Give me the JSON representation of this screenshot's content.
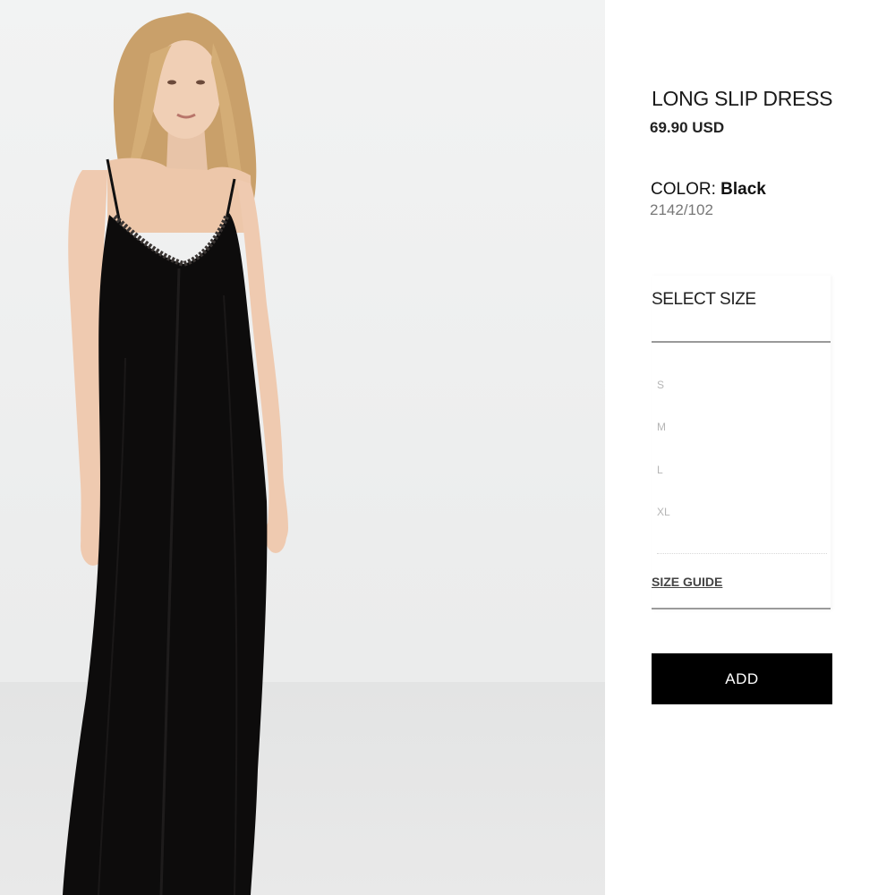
{
  "product": {
    "title": "LONG SLIP DRESS",
    "price": "69.90 USD",
    "color_label": "COLOR:",
    "color_value": "Black",
    "reference": "2142/102",
    "image_alt": "Model wearing long black slip dress"
  },
  "size_selector": {
    "heading": "SELECT SIZE",
    "options": [
      "S",
      "M",
      "L",
      "XL"
    ],
    "size_guide_label": "SIZE GUIDE"
  },
  "actions": {
    "add_label": "ADD"
  },
  "colors": {
    "add_button_bg": "#000000",
    "add_button_text": "#ffffff",
    "divider": "#9a9a9a",
    "size_option_text": "#b5b5b5"
  }
}
